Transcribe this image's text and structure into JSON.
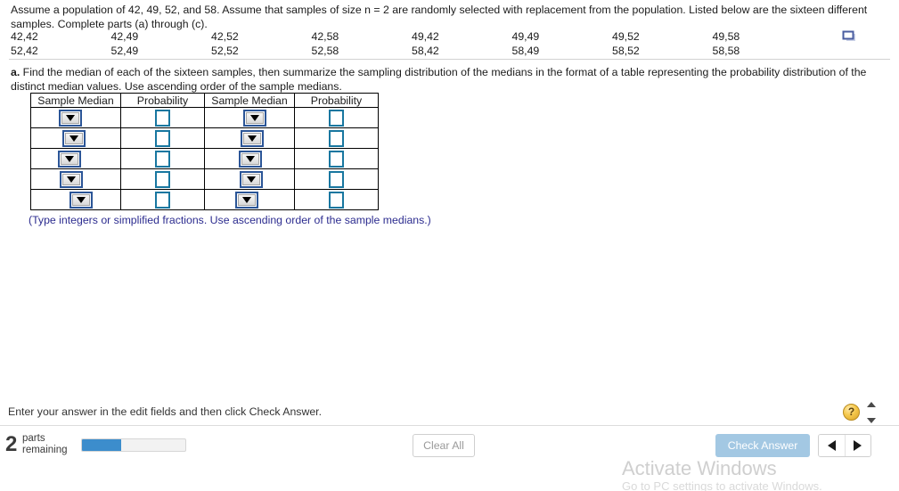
{
  "problem": {
    "statement": "Assume a population of 42, 49, 52, and 58. Assume that samples of size n = 2 are randomly selected with replacement from the population. Listed below are the sixteen different samples. Complete parts (a) through (c).",
    "samples_row1": [
      "42,42",
      "42,49",
      "42,52",
      "42,58",
      "49,42",
      "49,49",
      "49,52",
      "49,58"
    ],
    "samples_row2": [
      "52,42",
      "52,49",
      "52,52",
      "52,58",
      "58,42",
      "58,49",
      "58,52",
      "58,58"
    ],
    "part_a_label": "a.",
    "part_a_text": " Find the median of each of the sixteen samples, then summarize the sampling distribution of the medians in the format of a table representing the probability distribution of the distinct median values. Use ascending order of the sample medians.",
    "hint": "(Type integers or simplified fractions. Use ascending order of the sample medians.)"
  },
  "answer_table": {
    "headers": [
      "Sample Median",
      "Probability",
      "Sample Median",
      "Probability"
    ],
    "row_count": 5,
    "median_value": "",
    "probability_value": "",
    "dropdown_glyph": "triangle-down"
  },
  "status_bar": {
    "message": "Enter your answer in the edit fields and then click Check Answer.",
    "help_label": "?"
  },
  "bottom_bar": {
    "parts_number": "2",
    "parts_line1": "parts",
    "parts_line2": "remaining",
    "progress_percent": 38,
    "clear_all_label": "Clear All",
    "check_answer_label": "Check Answer"
  },
  "watermark": {
    "title": "Activate Windows",
    "subtitle": "Go to PC settings to activate Windows."
  },
  "colors": {
    "accent_blue": "#3c8dcc",
    "check_answer_bg": "#a3c8e3",
    "dropdown_border": "#2b5597",
    "input_border": "#1877a0",
    "hint_text": "#2c2c8f",
    "help_gold": "#f5c84b"
  }
}
